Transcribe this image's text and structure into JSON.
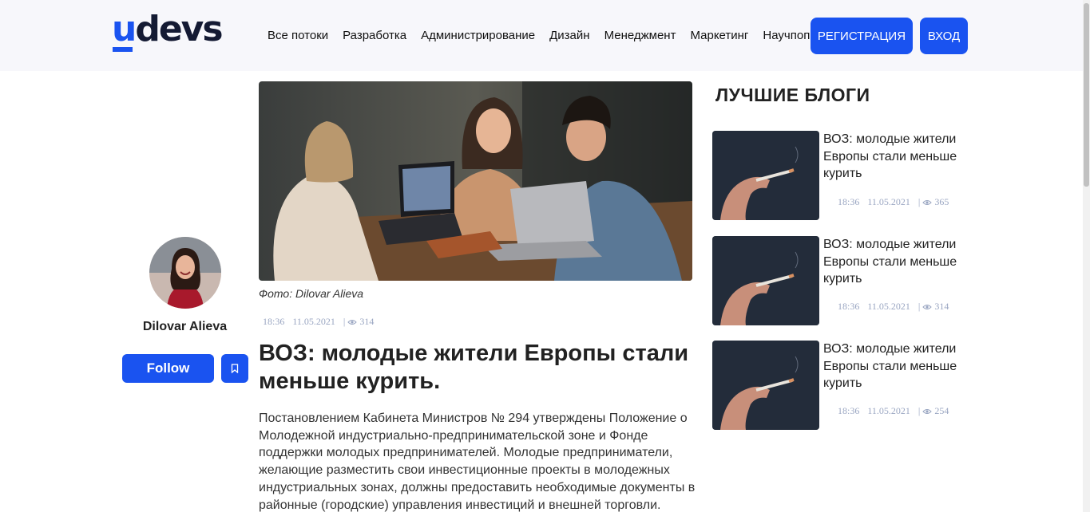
{
  "header": {
    "logo": "udevs",
    "nav": [
      "Все потоки",
      "Разработка",
      "Администрирование",
      "Дизайн",
      "Менеджмент",
      "Маркетинг",
      "Научпоп"
    ],
    "register_label": "РЕГИСТРАЦИЯ",
    "login_label": "ВХОД"
  },
  "author": {
    "name": "Dilovar Alieva",
    "follow_label": "Follow"
  },
  "article": {
    "photo_caption": "Фото: Dilovar Alieva",
    "time": "18:36",
    "date": "11.05.2021",
    "separator": "|",
    "views": "314",
    "title": "ВОЗ: молодые жители Европы стали меньше курить.",
    "body": "Постановлением Кабинета Министров № 294 утверждены Положение о Молодежной индустриально-предпринимательской зоне и Фонде поддержки молодых предпринимателей. Молодые предприниматели, желающие разместить свои инвестиционные проекты в молодежных индустриальных зонах, должны предоставить необходимые документы в районные (городские) управления инвестиций и внешней торговли."
  },
  "sidebar": {
    "heading": "ЛУЧШИЕ БЛОГИ",
    "cards": [
      {
        "title": "ВОЗ: молодые жители Европы стали меньше курить",
        "time": "18:36",
        "date": "11.05.2021",
        "separator": "|",
        "views": "365"
      },
      {
        "title": "ВОЗ: молодые жители Европы стали меньше курить",
        "time": "18:36",
        "date": "11.05.2021",
        "separator": "|",
        "views": "314"
      },
      {
        "title": "ВОЗ: молодые жители Европы стали меньше курить",
        "time": "18:36",
        "date": "11.05.2021",
        "separator": "|",
        "views": "254"
      }
    ]
  },
  "colors": {
    "accent": "#1a53f0",
    "header_bg": "#f7f7fb",
    "meta_text": "#9aa6c2",
    "logo_dark": "#141a33"
  },
  "icons": {
    "views": "eye-icon",
    "bookmark": "bookmark-icon"
  }
}
